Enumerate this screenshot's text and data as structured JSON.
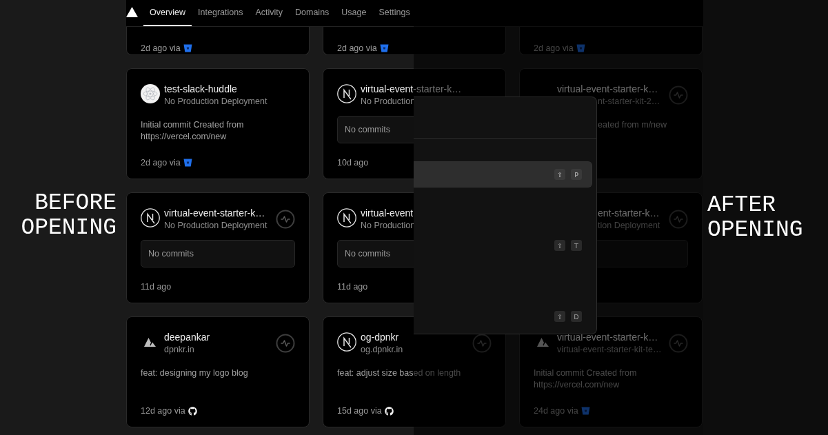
{
  "before_label": "BEFORE OPENING",
  "after_label": "AFTER OPENING",
  "nav": {
    "tabs": [
      {
        "label": "Overview",
        "selected": true
      },
      {
        "label": "Integrations",
        "selected": false
      },
      {
        "label": "Activity",
        "selected": false
      },
      {
        "label": "Domains",
        "selected": false
      },
      {
        "label": "Usage",
        "selected": false
      },
      {
        "label": "Settings",
        "selected": false
      }
    ]
  },
  "cards": [
    {
      "kind": "cut",
      "time": "2d ago via",
      "via": {
        "kind": "bitbucket"
      }
    },
    {
      "kind": "cut",
      "time": "2d ago via",
      "via": {
        "kind": "bitbucket"
      }
    },
    {
      "kind": "cut",
      "time": "2d ago via",
      "via": {
        "kind": "bitbucket"
      }
    },
    {
      "kind": "message",
      "logo": {
        "kind": "atom"
      },
      "title": "test-slack-huddle",
      "subtitle": "No Production Deployment",
      "pulse": false,
      "message": "Initial commit Created from https://vercel.com/new",
      "time": "2d ago via",
      "via": {
        "kind": "bitbucket"
      }
    },
    {
      "kind": "commits",
      "logo": {
        "kind": "next"
      },
      "title": "virtual-event-starter-k…",
      "subtitle": "No Production",
      "pulse": false,
      "box_text": "No commits",
      "time": "10d ago"
    },
    {
      "kind": "covered",
      "title": "virtual-event-starter-k…",
      "subtitle": "nt-starter-kit-2…",
      "pulse": true,
      "message": "eated from m/new"
    },
    {
      "kind": "commits",
      "logo": {
        "kind": "next"
      },
      "title": "virtual-event-starter-k…",
      "subtitle": "No Production Deployment",
      "pulse": true,
      "box_text": "No commits",
      "time": "11d ago"
    },
    {
      "kind": "commits",
      "logo": {
        "kind": "next"
      },
      "title": "virtual-event",
      "subtitle": "No Production",
      "pulse": false,
      "box_text": "No commits",
      "time": "11d ago"
    },
    {
      "kind": "covered",
      "title": "ent-starter-k…",
      "subtitle": "tion Deployment",
      "pulse": true
    },
    {
      "kind": "message",
      "logo": {
        "kind": "peaks"
      },
      "title": "deepankar",
      "subtitle": "dpnkr.in",
      "pulse": true,
      "message": "feat: designing my logo blog",
      "time": "12d ago via",
      "via": {
        "kind": "github"
      }
    },
    {
      "kind": "message",
      "logo": {
        "kind": "next"
      },
      "title": "og-dpnkr",
      "subtitle": "og.dpnkr.in",
      "pulse": true,
      "message": "feat: adjust size based on length",
      "time": "15d ago via",
      "via": {
        "kind": "github"
      }
    },
    {
      "kind": "message",
      "logo": {
        "kind": "peaks"
      },
      "title": "virtual-event-starter-k…",
      "subtitle": "virtual-event-starter-kit-te…",
      "pulse": true,
      "message": "Initial commit Created from https://vercel.com/new",
      "time": "24d ago via",
      "via": {
        "kind": "bitbucket"
      }
    }
  ],
  "command_menu": {
    "items": [
      {
        "selected": true,
        "keys": [
          "⇧",
          "P"
        ]
      },
      {
        "selected": false,
        "keys": [
          "⇧",
          "T"
        ]
      },
      {
        "selected": false,
        "keys": [
          "⇧",
          "D"
        ]
      }
    ]
  }
}
